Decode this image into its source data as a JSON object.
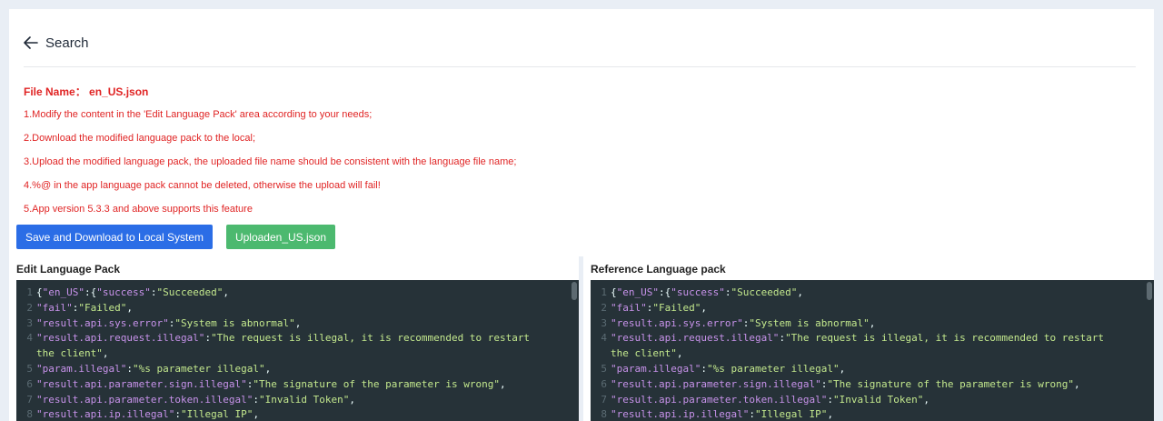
{
  "header": {
    "back_label": "Search"
  },
  "notes": {
    "file_name": "File Name： en_US.json",
    "lines": [
      "1.Modify the content in the 'Edit Language Pack' area according to your needs;",
      "2.Download the modified language pack to the local;",
      "3.Upload the modified language pack, the uploaded file name should be consistent with the language file name;",
      "4.%@ in the app language pack cannot be deleted, otherwise the upload will fail!",
      "5.App version 5.3.3 and above supports this feature"
    ]
  },
  "buttons": {
    "save_download": "Save and Download to Local System",
    "upload": "Uploaden_US.json"
  },
  "panels": {
    "edit_title": "Edit Language Pack",
    "reference_title": "Reference Language pack"
  },
  "code_lines": [
    {
      "n": "1",
      "parts": [
        [
          "p",
          "{"
        ],
        [
          "k",
          "\"en_US\""
        ],
        [
          "p",
          ":{"
        ],
        [
          "k",
          "\"success\""
        ],
        [
          "p",
          ":"
        ],
        [
          "s",
          "\"Succeeded\""
        ],
        [
          "p",
          ","
        ]
      ]
    },
    {
      "n": "2",
      "parts": [
        [
          "k",
          "\"fail\""
        ],
        [
          "p",
          ":"
        ],
        [
          "s",
          "\"Failed\""
        ],
        [
          "p",
          ","
        ]
      ]
    },
    {
      "n": "3",
      "parts": [
        [
          "k",
          "\"result.api.sys.error\""
        ],
        [
          "p",
          ":"
        ],
        [
          "s",
          "\"System is abnormal\""
        ],
        [
          "p",
          ","
        ]
      ]
    },
    {
      "n": "4",
      "parts": [
        [
          "k",
          "\"result.api.request.illegal\""
        ],
        [
          "p",
          ":"
        ],
        [
          "s",
          "\"The request is illegal, it is recommended to restart"
        ]
      ]
    },
    {
      "n": "",
      "parts": [
        [
          "s",
          "the client\""
        ],
        [
          "p",
          ","
        ]
      ]
    },
    {
      "n": "5",
      "parts": [
        [
          "k",
          "\"param.illegal\""
        ],
        [
          "p",
          ":"
        ],
        [
          "s",
          "\"%s parameter illegal\""
        ],
        [
          "p",
          ","
        ]
      ]
    },
    {
      "n": "6",
      "parts": [
        [
          "k",
          "\"result.api.parameter.sign.illegal\""
        ],
        [
          "p",
          ":"
        ],
        [
          "s",
          "\"The signature of the parameter is wrong\""
        ],
        [
          "p",
          ","
        ]
      ]
    },
    {
      "n": "7",
      "parts": [
        [
          "k",
          "\"result.api.parameter.token.illegal\""
        ],
        [
          "p",
          ":"
        ],
        [
          "s",
          "\"Invalid Token\""
        ],
        [
          "p",
          ","
        ]
      ]
    },
    {
      "n": "8",
      "parts": [
        [
          "k",
          "\"result.api.ip.illegal\""
        ],
        [
          "p",
          ":"
        ],
        [
          "s",
          "\"Illegal IP\""
        ],
        [
          "p",
          ","
        ]
      ]
    }
  ],
  "colors": {
    "notice_red": "#e02424",
    "primary_blue": "#2b6de6",
    "success_green": "#4cb96f",
    "editor_bg": "#263238"
  }
}
